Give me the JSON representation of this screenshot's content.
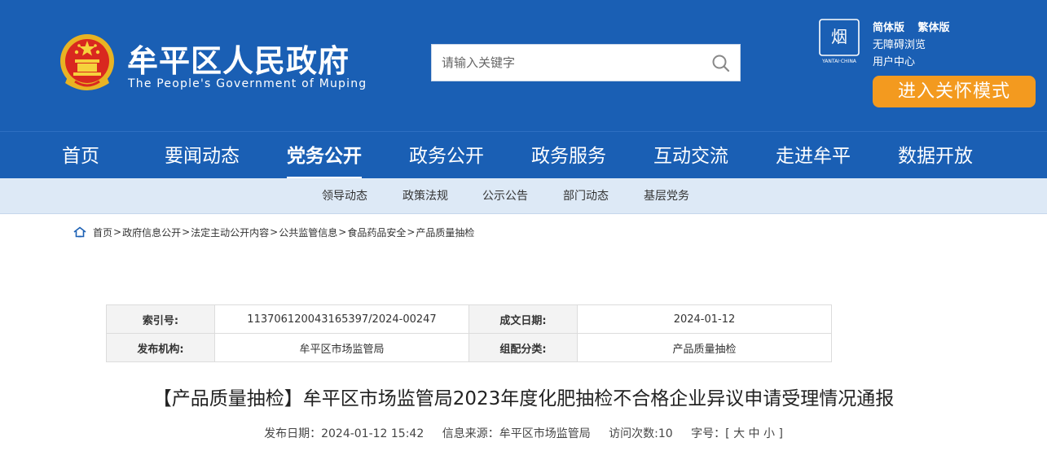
{
  "header": {
    "title": "牟平区人民政府",
    "subtitle": "The People's Government of Muping",
    "search_placeholder": "请输入关键字",
    "links": {
      "simplified": "简体版",
      "traditional": "繁体版",
      "accessible": "无障碍浏览",
      "user_center": "用户中心"
    },
    "care_mode": "进入关怀模式",
    "logo_text": "YANTAI·CHINA"
  },
  "nav": [
    {
      "label": "首页"
    },
    {
      "label": "要闻动态"
    },
    {
      "label": "党务公开"
    },
    {
      "label": "政务公开"
    },
    {
      "label": "政务服务"
    },
    {
      "label": "互动交流"
    },
    {
      "label": "走进牟平"
    },
    {
      "label": "数据开放"
    }
  ],
  "subnav": [
    {
      "label": "领导动态"
    },
    {
      "label": "政策法规"
    },
    {
      "label": "公示公告"
    },
    {
      "label": "部门动态"
    },
    {
      "label": "基层党务"
    }
  ],
  "breadcrumb": [
    "首页",
    "政府信息公开",
    "法定主动公开内容",
    "公共监管信息",
    "食品药品安全",
    "产品质量抽检"
  ],
  "info": {
    "index_label": "索引号:",
    "index_value": "113706120043165397/2024-00247",
    "date_label": "成文日期:",
    "date_value": "2024-01-12",
    "org_label": "发布机构:",
    "org_value": "牟平区市场监管局",
    "category_label": "组配分类:",
    "category_value": "产品质量抽检"
  },
  "article": {
    "title": "【产品质量抽检】牟平区市场监管局2023年度化肥抽检不合格企业异议申请受理情况通报",
    "publish_date": "发布日期：2024-01-12 15:42",
    "source": "信息来源：牟平区市场监管局",
    "visits": "访问次数:10",
    "font_size_label": "字号：[",
    "font_large": "大",
    "font_medium": "中",
    "font_small": "小",
    "font_close": "]"
  },
  "colors": {
    "primary": "#1a5fb4",
    "accent": "#f39a1f",
    "subnav_bg": "#dde9f6"
  }
}
